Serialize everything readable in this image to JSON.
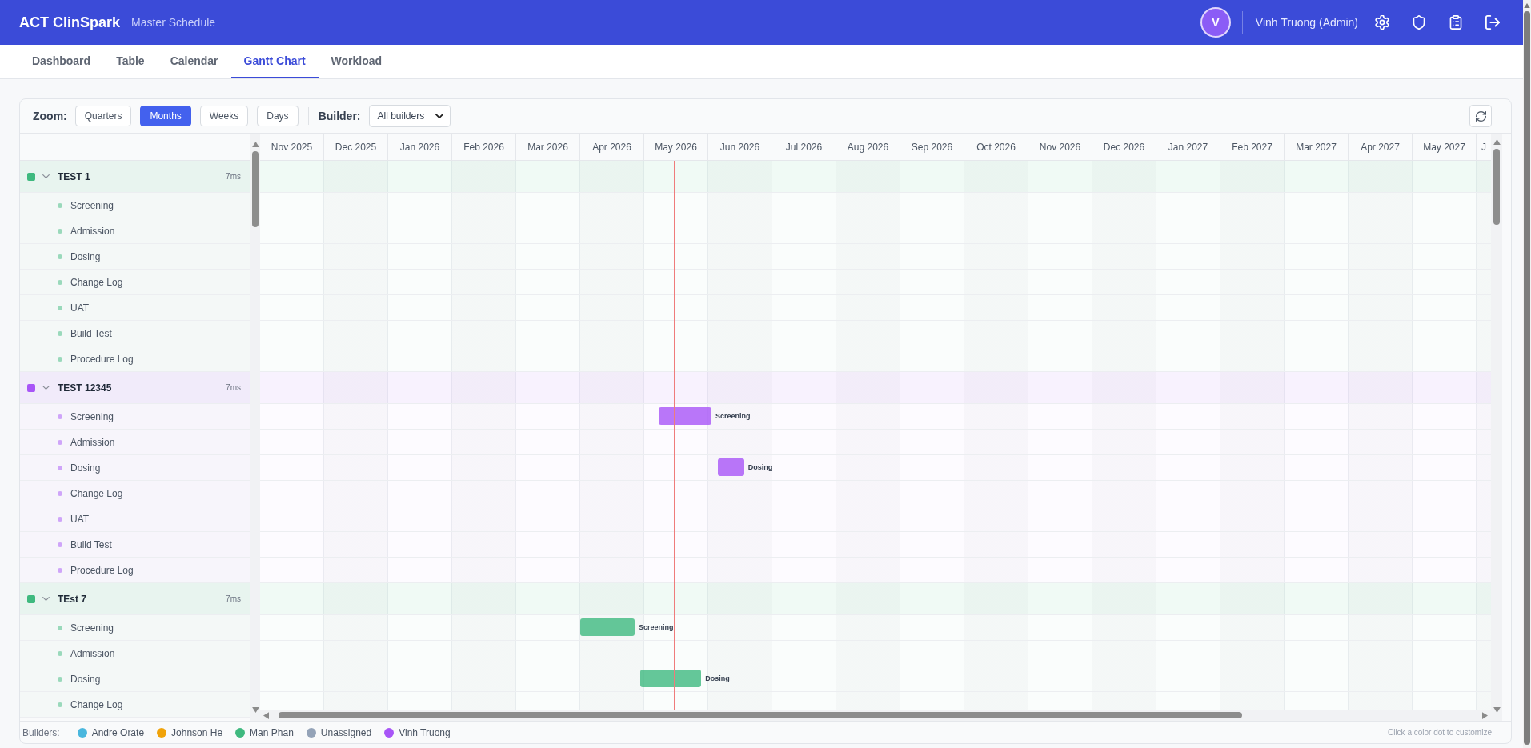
{
  "header": {
    "app_name": "ACT ClinSpark",
    "page_title": "Master Schedule",
    "avatar_initial": "V",
    "user_name": "Vinh Truong (Admin)"
  },
  "tabs": [
    {
      "label": "Dashboard",
      "selected": false
    },
    {
      "label": "Table",
      "selected": false
    },
    {
      "label": "Calendar",
      "selected": false
    },
    {
      "label": "Gantt Chart",
      "selected": true
    },
    {
      "label": "Workload",
      "selected": false
    }
  ],
  "toolbar": {
    "zoom_label": "Zoom:",
    "zoom_options": [
      {
        "label": "Quarters",
        "selected": false
      },
      {
        "label": "Months",
        "selected": true
      },
      {
        "label": "Weeks",
        "selected": false
      },
      {
        "label": "Days",
        "selected": false
      }
    ],
    "builder_label": "Builder:",
    "builder_value": "All builders"
  },
  "timeline": {
    "months": [
      "Nov 2025",
      "Dec 2025",
      "Jan 2026",
      "Feb 2026",
      "Mar 2026",
      "Apr 2026",
      "May 2026",
      "Jun 2026",
      "Jul 2026",
      "Aug 2026",
      "Sep 2026",
      "Oct 2026",
      "Nov 2026",
      "Dec 2026",
      "Jan 2027",
      "Feb 2027",
      "Mar 2027",
      "Apr 2027",
      "May 2027",
      "J"
    ]
  },
  "groups": [
    {
      "name": "TEST 1",
      "count": "7ms",
      "color": "#3fb97f",
      "expanded": true,
      "tasks": [
        {
          "name": "Screening"
        },
        {
          "name": "Admission"
        },
        {
          "name": "Dosing"
        },
        {
          "name": "Change Log"
        },
        {
          "name": "UAT"
        },
        {
          "name": "Build Test"
        },
        {
          "name": "Procedure Log"
        }
      ]
    },
    {
      "name": "TEST 12345",
      "count": "7ms",
      "color": "#a855f7",
      "expanded": true,
      "tasks": [
        {
          "name": "Screening",
          "bar": {
            "label": "Screening"
          }
        },
        {
          "name": "Admission"
        },
        {
          "name": "Dosing",
          "bar": {
            "label": "Dosing"
          }
        },
        {
          "name": "Change Log"
        },
        {
          "name": "UAT"
        },
        {
          "name": "Build Test"
        },
        {
          "name": "Procedure Log"
        }
      ]
    },
    {
      "name": "TEst 7",
      "count": "7ms",
      "color": "#3fb97f",
      "expanded": true,
      "tasks": [
        {
          "name": "Screening",
          "bar": {
            "label": "Screening"
          }
        },
        {
          "name": "Admission"
        },
        {
          "name": "Dosing",
          "bar": {
            "label": "Dosing"
          }
        },
        {
          "name": "Change Log"
        }
      ]
    }
  ],
  "legend": {
    "label": "Builders:",
    "builders": [
      {
        "name": "Andre Orate",
        "color": "#4ab7de"
      },
      {
        "name": "Johnson He",
        "color": "#f0a30a"
      },
      {
        "name": "Man Phan",
        "color": "#3fb97f"
      },
      {
        "name": "Unassigned",
        "color": "#94a3b8"
      },
      {
        "name": "Vinh Truong",
        "color": "#a855f7"
      }
    ],
    "hint": "Click a color dot to customize"
  }
}
